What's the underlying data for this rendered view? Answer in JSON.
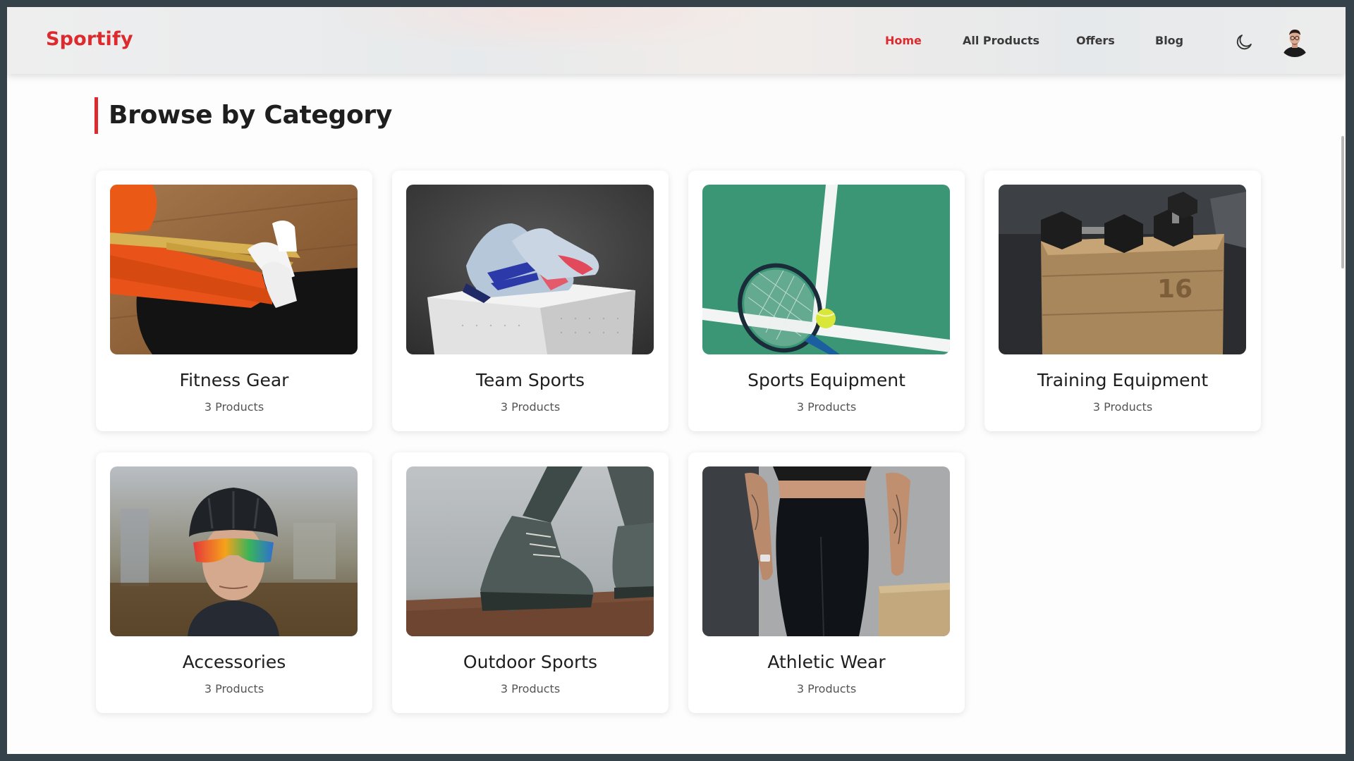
{
  "header": {
    "logo": "Sportify",
    "nav": [
      {
        "label": "Home",
        "active": true
      },
      {
        "label": "All Products",
        "active": false
      },
      {
        "label": "Offers",
        "active": false
      },
      {
        "label": "Blog",
        "active": false
      }
    ],
    "theme_icon": "moon-icon",
    "avatar_icon": "user-avatar"
  },
  "main": {
    "section_title": "Browse by Category",
    "categories": [
      {
        "name": "Fitness Gear",
        "count": "3 Products",
        "image": "resistance-band-photo"
      },
      {
        "name": "Team Sports",
        "count": "3 Products",
        "image": "football-boots-photo"
      },
      {
        "name": "Sports Equipment",
        "count": "3 Products",
        "image": "tennis-racket-photo"
      },
      {
        "name": "Training Equipment",
        "count": "3 Products",
        "image": "dumbbells-photo"
      },
      {
        "name": "Accessories",
        "count": "3 Products",
        "image": "cycling-helmet-photo"
      },
      {
        "name": "Outdoor Sports",
        "count": "3 Products",
        "image": "hiking-shoes-photo"
      },
      {
        "name": "Athletic Wear",
        "count": "3 Products",
        "image": "leggings-photo"
      }
    ]
  },
  "colors": {
    "accent": "#dc2a2e",
    "text": "#1e1e1e",
    "muted": "#555555",
    "background": "#fdfdfd",
    "frame": "#36424a"
  }
}
